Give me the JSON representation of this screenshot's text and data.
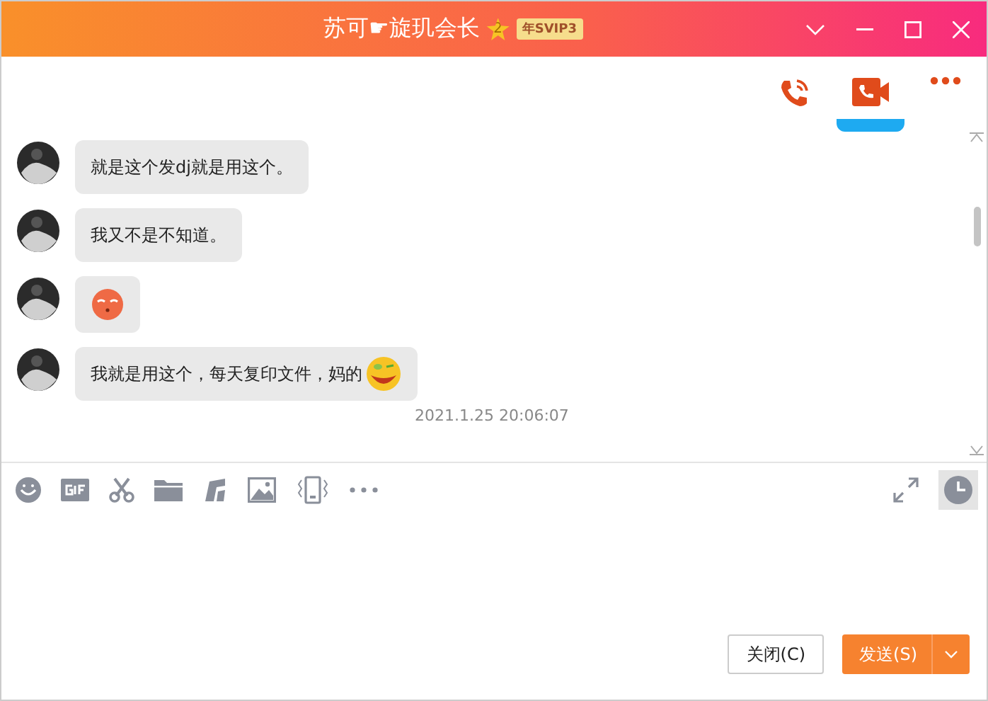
{
  "window": {
    "title": "苏可☛旋玑会长",
    "level_badge": "2",
    "vip_badge": "年SVIP3"
  },
  "messages": [
    {
      "text": "就是这个发dj就是用这个。",
      "emoji": false
    },
    {
      "text": "我又不是不知道。",
      "emoji": false
    },
    {
      "emoji": true
    },
    {
      "text": "我就是用这个，每天复印文件，妈的",
      "emoji": true
    }
  ],
  "timestamp": "2021.1.25 20:06:07",
  "buttons": {
    "close": "关闭(C)",
    "send": "发送(S)"
  }
}
